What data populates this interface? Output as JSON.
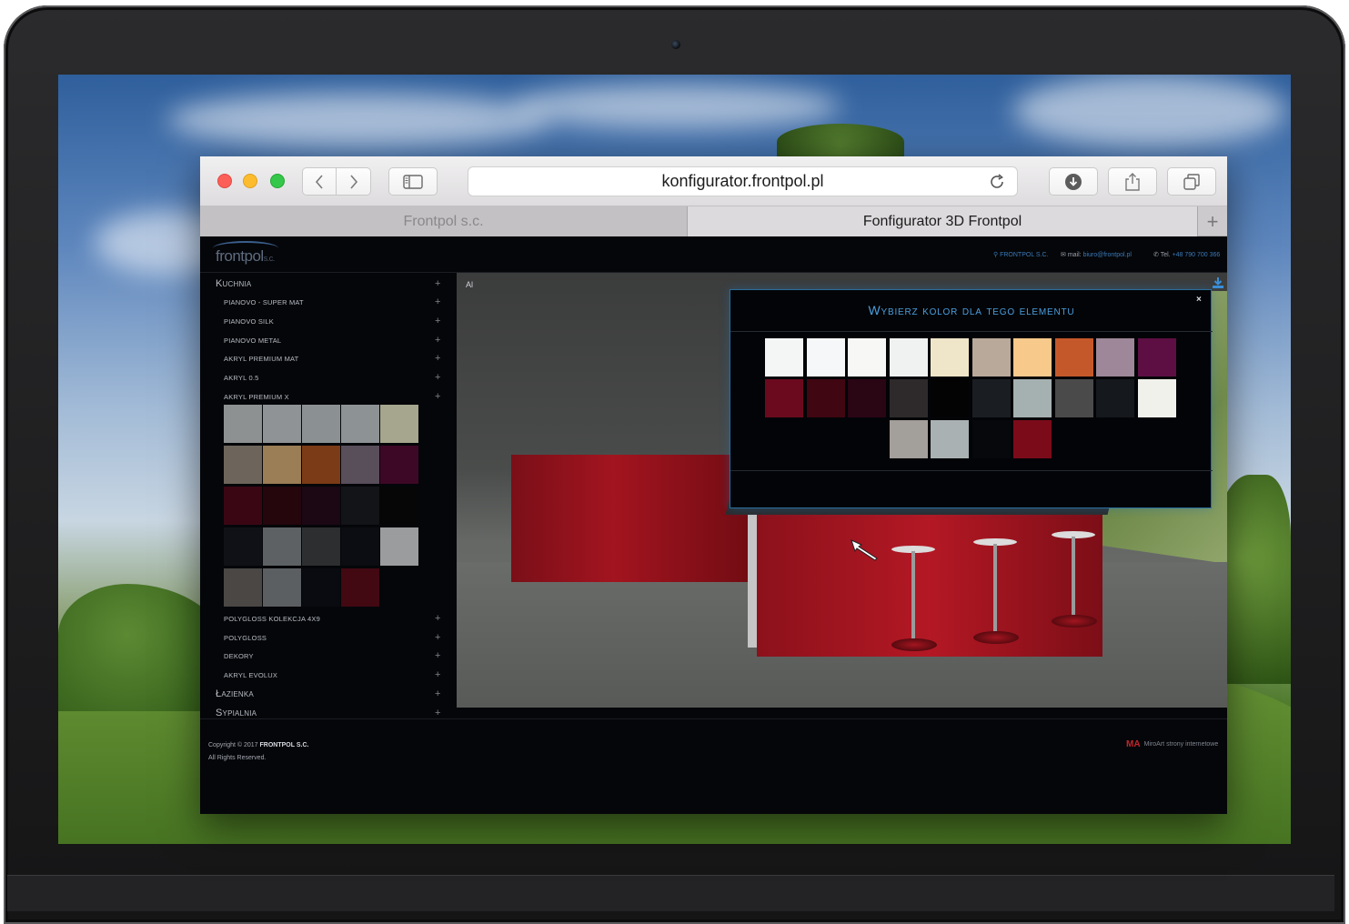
{
  "browser": {
    "url": "konfigurator.frontpol.pl",
    "tabs": [
      {
        "label": "Frontpol s.c."
      },
      {
        "label": "Fonfigurator 3D Frontpol"
      }
    ],
    "new_tab_label": "+"
  },
  "site": {
    "logo": "frontpol",
    "logo_suffix": "s.c.",
    "contact": {
      "company": "FRONTPOL S.C.",
      "mail_label": "mail:",
      "mail": "biuro@frontpol.pl",
      "tel_label": "Tel.",
      "tel": "+48 790 700 366"
    }
  },
  "sidebar": {
    "kuchnia": "Kuchnia",
    "items": [
      "PIANOVO - SUPER MAT",
      "PIANOVO SILK",
      "PIANOVO METAL",
      "AKRYL PREMIUM MAT",
      "AKRYL 0.5",
      "AKRYL PREMIUM X"
    ],
    "items_after": [
      "POLYGLOSS KOLEKCJA 4X9",
      "POLYGLOSS",
      "DEKORY",
      "AKRYL EVOLUX"
    ],
    "lazienka": "Łazienka",
    "sypialnia": "Sypialnia",
    "expand": "+",
    "swatch_colors": [
      "#8e9192",
      "#8f9396",
      "#8b9093",
      "#8d9294",
      "#a6a58e",
      "#6d655b",
      "#9b7e56",
      "#7b3b16",
      "#584f5b",
      "#3d0826",
      "#3b0613",
      "#24060c",
      "#1b0814",
      "#121418",
      "#060606",
      "#0f1116",
      "#5d6163",
      "#2d2e30",
      "#0b0d12",
      "#9a9c9d",
      "#4a4745",
      "#5c5f61",
      "#0a0b11",
      "#420913"
    ]
  },
  "viewer": {
    "label_fragment": "Al"
  },
  "modal": {
    "title": "Wybierz kolor dla tego elementu",
    "close": "×",
    "colors": [
      "#f4f6f6",
      "#f6f7f8",
      "#f7f7f5",
      "#f0f1f1",
      "#efe5c8",
      "#b9a99a",
      "#f7c98b",
      "#c4582a",
      "#9e8799",
      "#5d0f43",
      "#6b0a1e",
      "#400612",
      "#2a0514",
      "#2e2a2b",
      "#030303",
      "#1a1d21",
      "#a5b0b1",
      "#4a4a4b",
      "#15181c",
      "#f1f1ec",
      "#a39f9a",
      "#aab1b2",
      "#07080b",
      "#7c0b1a"
    ]
  },
  "footer": {
    "copyright_prefix": "Copyright © 2017",
    "company": "FRONTPOL S.C.",
    "rights": "All Rights Reserved.",
    "credit_logo": "MA",
    "credit": "MiroArt strony internetowe"
  }
}
